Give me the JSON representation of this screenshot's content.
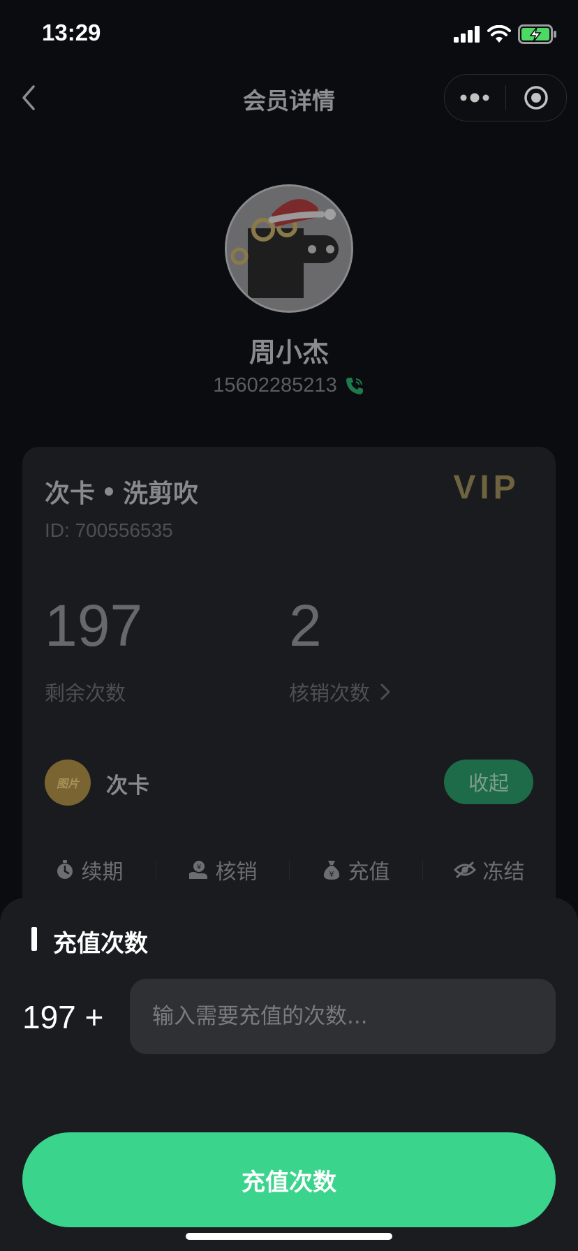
{
  "status_bar": {
    "time": "13:29"
  },
  "nav": {
    "title": "会员详情"
  },
  "member": {
    "name": "周小杰",
    "phone": "15602285213"
  },
  "card": {
    "title": "次卡",
    "subtitle": "洗剪吹",
    "badge": "VIP",
    "id_label": "ID:",
    "id_value": "700556535",
    "remaining": {
      "value": "197",
      "label": "剩余次数"
    },
    "used": {
      "value": "2",
      "label": "核销次数"
    },
    "type_icon_text": "图片",
    "type_label": "次卡",
    "collapse_label": "收起",
    "actions": [
      {
        "label": "续期",
        "icon": "stopwatch-icon"
      },
      {
        "label": "核销",
        "icon": "hand-coin-icon"
      },
      {
        "label": "充值",
        "icon": "money-bag-icon"
      },
      {
        "label": "冻结",
        "icon": "eye-off-icon"
      }
    ]
  },
  "recharge": {
    "title": "充值次数",
    "prefix": "197 +",
    "placeholder": "输入需要充值的次数...",
    "submit_label": "充值次数"
  },
  "colors": {
    "accent_green": "#3ad48c",
    "background": "#0b0c0f",
    "sheet": "#1b1c20",
    "vip_gold": "#6e623f"
  }
}
